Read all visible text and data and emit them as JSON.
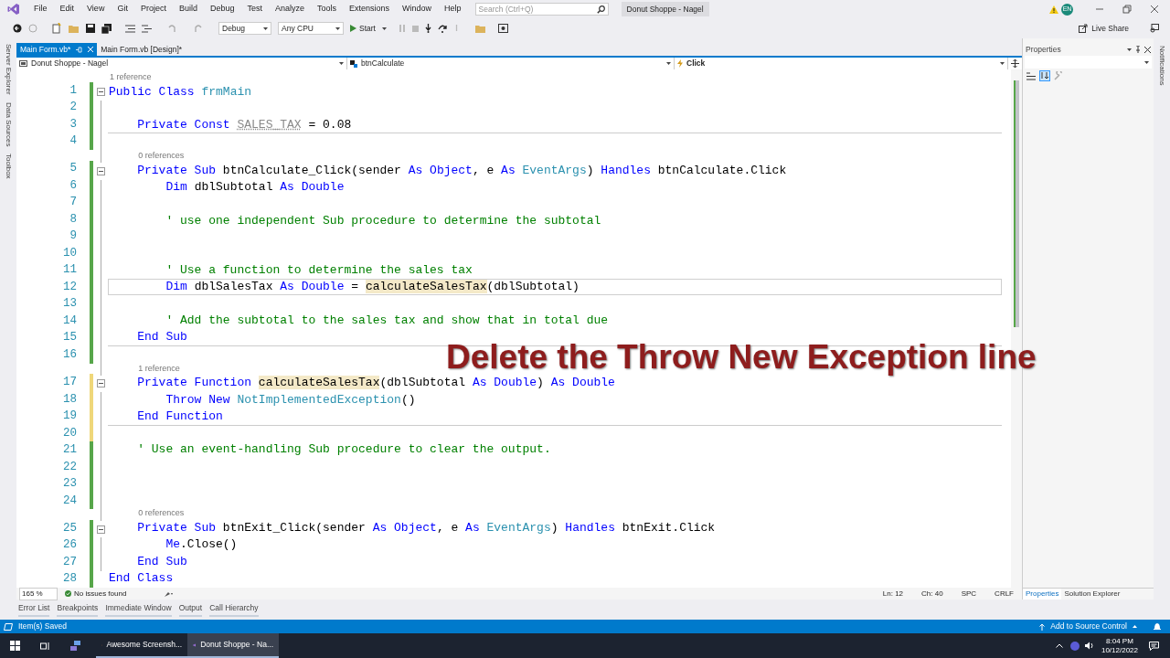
{
  "menu": [
    "File",
    "Edit",
    "View",
    "Git",
    "Project",
    "Build",
    "Debug",
    "Test",
    "Analyze",
    "Tools",
    "Extensions",
    "Window",
    "Help"
  ],
  "search": {
    "placeholder": "Search (Ctrl+Q)"
  },
  "window": {
    "title": "Donut Shoppe - Nagel",
    "user_initials": "EN"
  },
  "toolbar": {
    "configuration": "Debug",
    "platform": "Any CPU",
    "start": "Start",
    "live_share": "Live Share"
  },
  "side_tabs": [
    "Server Explorer",
    "Data Sources",
    "Toolbox"
  ],
  "document_tabs": [
    {
      "label": "Main Form.vb*",
      "selected": true
    },
    {
      "label": "Main Form.vb [Design]*",
      "selected": false
    }
  ],
  "navigation": {
    "project": "Donut Shoppe - Nagel",
    "object": "btnCalculate",
    "event": "Click"
  },
  "code_lines": [
    {
      "num": "1",
      "lens": "1 reference",
      "fold": true,
      "unsaved": false,
      "current": false,
      "separator": false,
      "tokens": [
        {
          "text": "Public Class ",
          "kind": "keyword"
        },
        {
          "text": "frmMain",
          "kind": "type"
        }
      ]
    },
    {
      "num": "2",
      "fold": false,
      "unsaved": false,
      "current": false,
      "separator": false
    },
    {
      "num": "3",
      "fold": false,
      "unsaved": false,
      "current": false,
      "separator": true,
      "tokens": [
        {
          "text": "    Private Const ",
          "kind": "keyword"
        },
        {
          "text": "SALES_TAX",
          "kind": "unused"
        },
        {
          "text": " = 0.08",
          "kind": "plain"
        }
      ]
    },
    {
      "num": "4",
      "fold": false,
      "unsaved": false,
      "current": false,
      "separator": false
    },
    {
      "num": "5",
      "lens": "0 references",
      "fold": true,
      "unsaved": false,
      "current": false,
      "separator": false,
      "tokens": [
        {
          "text": "    Private Sub ",
          "kind": "keyword"
        },
        {
          "text": "btnCalculate_Click(sender ",
          "kind": "plain"
        },
        {
          "text": "As ",
          "kind": "keyword"
        },
        {
          "text": "Object",
          "kind": "keyword"
        },
        {
          "text": ", e ",
          "kind": "plain"
        },
        {
          "text": "As ",
          "kind": "keyword"
        },
        {
          "text": "EventArgs",
          "kind": "type"
        },
        {
          "text": ") ",
          "kind": "plain"
        },
        {
          "text": "Handles ",
          "kind": "keyword"
        },
        {
          "text": "btnCalculate.Click",
          "kind": "plain"
        }
      ]
    },
    {
      "num": "6",
      "fold": false,
      "unsaved": false,
      "current": false,
      "separator": false,
      "tokens": [
        {
          "text": "        Dim ",
          "kind": "keyword"
        },
        {
          "text": "dblSubtotal ",
          "kind": "plain"
        },
        {
          "text": "As Double",
          "kind": "keyword"
        }
      ]
    },
    {
      "num": "7",
      "fold": false,
      "unsaved": false,
      "current": false,
      "separator": false
    },
    {
      "num": "8",
      "fold": false,
      "unsaved": false,
      "current": false,
      "separator": false,
      "tokens": [
        {
          "text": "        ' use one independent Sub procedure to determine the subtotal",
          "kind": "comment"
        }
      ]
    },
    {
      "num": "9",
      "fold": false,
      "unsaved": false,
      "current": false,
      "separator": false
    },
    {
      "num": "10",
      "fold": false,
      "unsaved": false,
      "current": false,
      "separator": false
    },
    {
      "num": "11",
      "fold": false,
      "unsaved": false,
      "current": false,
      "separator": false,
      "tokens": [
        {
          "text": "        ' Use a function to determine the sales tax",
          "kind": "comment"
        }
      ]
    },
    {
      "num": "12",
      "fold": false,
      "unsaved": false,
      "current": true,
      "separator": false,
      "tokens": [
        {
          "text": "        Dim ",
          "kind": "keyword"
        },
        {
          "text": "dblSalesTax ",
          "kind": "plain"
        },
        {
          "text": "As Double",
          "kind": "keyword"
        },
        {
          "text": " = ",
          "kind": "plain"
        },
        {
          "text": "calculateSalesTax",
          "kind": "highlight"
        },
        {
          "text": "(dblSubtotal)",
          "kind": "plain"
        }
      ]
    },
    {
      "num": "13",
      "fold": false,
      "unsaved": false,
      "current": false,
      "separator": false
    },
    {
      "num": "14",
      "fold": false,
      "unsaved": false,
      "current": false,
      "separator": false,
      "tokens": [
        {
          "text": "        ' Add the subtotal to the sales tax and show that in total due",
          "kind": "comment"
        }
      ]
    },
    {
      "num": "15",
      "fold": false,
      "unsaved": false,
      "current": false,
      "separator": true,
      "tokens": [
        {
          "text": "    End Sub",
          "kind": "keyword"
        }
      ]
    },
    {
      "num": "16",
      "fold": false,
      "unsaved": false,
      "current": false,
      "separator": false
    },
    {
      "num": "17",
      "lens": "1 reference",
      "fold": true,
      "unsaved": true,
      "current": false,
      "separator": false,
      "tokens": [
        {
          "text": "    Private Function ",
          "kind": "keyword"
        },
        {
          "text": "calculateSalesTax",
          "kind": "highlight"
        },
        {
          "text": "(dblSubtotal ",
          "kind": "plain"
        },
        {
          "text": "As Double",
          "kind": "keyword"
        },
        {
          "text": ") ",
          "kind": "plain"
        },
        {
          "text": "As Double",
          "kind": "keyword"
        }
      ]
    },
    {
      "num": "18",
      "fold": false,
      "unsaved": true,
      "current": false,
      "separator": false,
      "tokens": [
        {
          "text": "        Throw New ",
          "kind": "keyword"
        },
        {
          "text": "NotImplementedException",
          "kind": "type"
        },
        {
          "text": "()",
          "kind": "plain"
        }
      ]
    },
    {
      "num": "19",
      "fold": false,
      "unsaved": true,
      "current": false,
      "separator": true,
      "tokens": [
        {
          "text": "    End Function",
          "kind": "keyword"
        }
      ]
    },
    {
      "num": "20",
      "fold": false,
      "unsaved": true,
      "current": false,
      "separator": false
    },
    {
      "num": "21",
      "fold": false,
      "unsaved": false,
      "current": false,
      "separator": false,
      "tokens": [
        {
          "text": "    ' Use an event-handling Sub procedure to clear the output.",
          "kind": "comment"
        }
      ]
    },
    {
      "num": "22",
      "fold": false,
      "unsaved": false,
      "current": false,
      "separator": false
    },
    {
      "num": "23",
      "fold": false,
      "unsaved": false,
      "current": false,
      "separator": false
    },
    {
      "num": "24",
      "fold": false,
      "unsaved": false,
      "current": false,
      "separator": false
    },
    {
      "num": "25",
      "lens": "0 references",
      "fold": true,
      "unsaved": false,
      "current": false,
      "separator": false,
      "tokens": [
        {
          "text": "    Private Sub ",
          "kind": "keyword"
        },
        {
          "text": "btnExit_Click(sender ",
          "kind": "plain"
        },
        {
          "text": "As ",
          "kind": "keyword"
        },
        {
          "text": "Object",
          "kind": "keyword"
        },
        {
          "text": ", e ",
          "kind": "plain"
        },
        {
          "text": "As ",
          "kind": "keyword"
        },
        {
          "text": "EventArgs",
          "kind": "type"
        },
        {
          "text": ") ",
          "kind": "plain"
        },
        {
          "text": "Handles ",
          "kind": "keyword"
        },
        {
          "text": "btnExit.Click",
          "kind": "plain"
        }
      ]
    },
    {
      "num": "26",
      "fold": false,
      "unsaved": false,
      "current": false,
      "separator": false,
      "tokens": [
        {
          "text": "        Me",
          "kind": "keyword"
        },
        {
          "text": ".Close()",
          "kind": "plain"
        }
      ]
    },
    {
      "num": "27",
      "fold": false,
      "unsaved": false,
      "current": false,
      "separator": false,
      "tokens": [
        {
          "text": "    End Sub",
          "kind": "keyword"
        }
      ]
    },
    {
      "num": "28",
      "fold": false,
      "unsaved": false,
      "current": false,
      "separator": false,
      "tokens": [
        {
          "text": "End Class",
          "kind": "keyword"
        }
      ]
    }
  ],
  "caption": "Delete the Throw New Exception line",
  "editor_status": {
    "zoom": "165 %",
    "issues": "No issues found",
    "line": "Ln: 12",
    "column": "Ch: 40",
    "whitespace": "SPC",
    "line_endings": "CRLF"
  },
  "properties_panel": {
    "title": "Properties",
    "tabs": [
      {
        "label": "Properties",
        "selected": true
      },
      {
        "label": "Solution Explorer",
        "selected": false
      }
    ]
  },
  "notifications_tab": "Notifications",
  "tool_tabs": [
    "Error List",
    "Breakpoints",
    "Immediate Window",
    "Output",
    "Call Hierarchy"
  ],
  "status_bar": {
    "message": "Item(s) Saved",
    "source_control": "Add to Source Control"
  },
  "taskbar": {
    "apps": [
      {
        "label": "Awesome Screensh...",
        "selected": false
      },
      {
        "label": "Donut Shoppe - Na...",
        "selected": true
      }
    ],
    "time": "8:04 PM",
    "date": "10/12/2022"
  }
}
